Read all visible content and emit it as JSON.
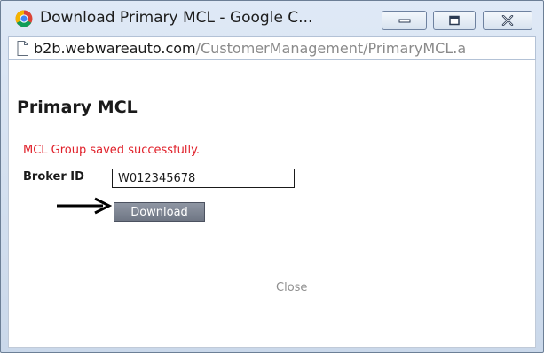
{
  "window": {
    "title": "Download Primary MCL - Google C...",
    "controls": {
      "minimize": "minimize-icon",
      "maximize": "maximize-icon",
      "close": "close-icon"
    }
  },
  "address_bar": {
    "domain": "b2b.webwareauto.com",
    "path": "/CustomerManagement/PrimaryMCL.a"
  },
  "page": {
    "title": "Primary MCL",
    "success_message": "MCL Group saved successfully.",
    "broker_id_label": "Broker ID",
    "broker_id_value": "W012345678",
    "download_label": "Download",
    "close_label": "Close"
  },
  "colors": {
    "success_text": "#e0202a",
    "button_bg": "#7a808d",
    "close_text": "#8f8f8f"
  }
}
